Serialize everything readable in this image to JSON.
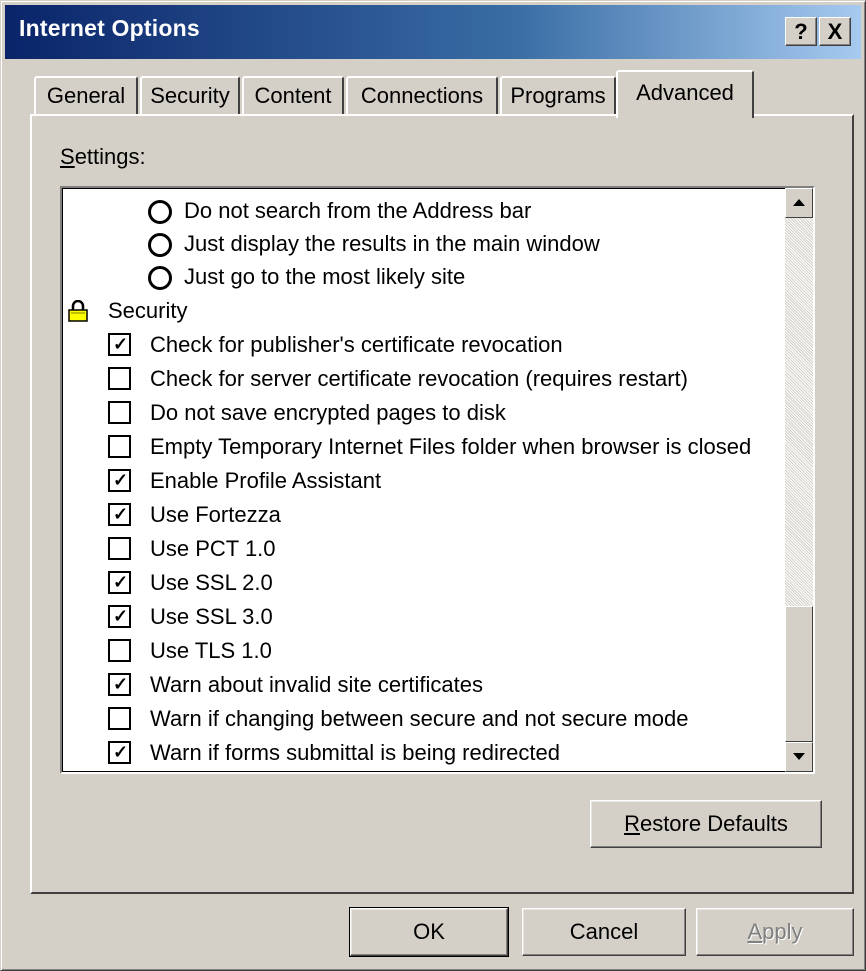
{
  "window": {
    "title": "Internet Options",
    "help_label": "?",
    "close_label": "X"
  },
  "tabs": [
    {
      "label": "General",
      "active": false
    },
    {
      "label": "Security",
      "active": false
    },
    {
      "label": "Content",
      "active": false
    },
    {
      "label": "Connections",
      "active": false
    },
    {
      "label": "Programs",
      "active": false
    },
    {
      "label": "Advanced",
      "active": true
    }
  ],
  "settings": {
    "label_accel": "S",
    "label_rest": "ettings:",
    "items": [
      {
        "type": "radio",
        "label": "Do not search from the Address bar",
        "checked": false
      },
      {
        "type": "radio",
        "label": "Just display the results in the main window",
        "checked": false
      },
      {
        "type": "radio",
        "label": "Just go to the most likely site",
        "checked": false
      },
      {
        "type": "group",
        "label": "Security",
        "icon": "lock-icon"
      },
      {
        "type": "checkbox",
        "label": "Check for publisher's certificate revocation",
        "checked": true
      },
      {
        "type": "checkbox",
        "label": "Check for server certificate revocation (requires restart)",
        "checked": false
      },
      {
        "type": "checkbox",
        "label": "Do not save encrypted pages to disk",
        "checked": false
      },
      {
        "type": "checkbox",
        "label": "Empty Temporary Internet Files folder when browser is closed",
        "checked": false
      },
      {
        "type": "checkbox",
        "label": "Enable Profile Assistant",
        "checked": true
      },
      {
        "type": "checkbox",
        "label": "Use Fortezza",
        "checked": true
      },
      {
        "type": "checkbox",
        "label": "Use PCT 1.0",
        "checked": false
      },
      {
        "type": "checkbox",
        "label": "Use SSL 2.0",
        "checked": true
      },
      {
        "type": "checkbox",
        "label": "Use SSL 3.0",
        "checked": true
      },
      {
        "type": "checkbox",
        "label": "Use TLS 1.0",
        "checked": false
      },
      {
        "type": "checkbox",
        "label": "Warn about invalid site certificates",
        "checked": true
      },
      {
        "type": "checkbox",
        "label": "Warn if changing between secure and not secure mode",
        "checked": false
      },
      {
        "type": "checkbox",
        "label": "Warn if forms submittal is being redirected",
        "checked": true
      }
    ]
  },
  "buttons": {
    "restore_accel": "R",
    "restore_rest": "estore Defaults",
    "ok": "OK",
    "cancel": "Cancel",
    "apply_accel": "A",
    "apply_rest": "pply",
    "apply_enabled": false
  },
  "scrollbar": {
    "position_fraction": 1.0
  }
}
